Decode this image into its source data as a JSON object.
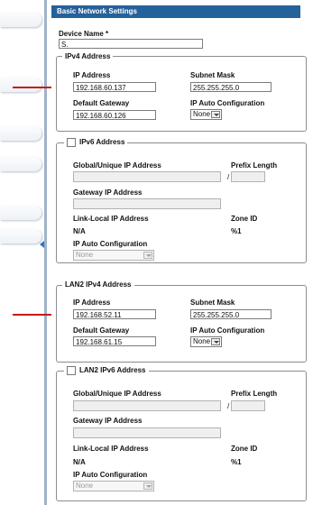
{
  "panel": {
    "title": "Basic Network Settings"
  },
  "device": {
    "name_label": "Device Name *",
    "name_value": "S."
  },
  "ipv4": {
    "legend": "IPv4 Address",
    "ip_label": "IP Address",
    "ip_value": "192.168.60.137",
    "mask_label": "Subnet Mask",
    "mask_value": "255.255.255.0",
    "gateway_label": "Default Gateway",
    "gateway_value": "192.168.60.126",
    "auto_label": "IP Auto Configuration",
    "auto_value": "None"
  },
  "ipv6": {
    "legend": "IPv6 Address",
    "global_label": "Global/Unique IP Address",
    "prefix_label": "Prefix Length",
    "slash": "/",
    "gateway_label": "Gateway IP Address",
    "linklocal_label": "Link-Local IP Address",
    "linklocal_value": "N/A",
    "zone_label": "Zone ID",
    "zone_value": "%1",
    "auto_label": "IP Auto Configuration",
    "auto_value": "None"
  },
  "lan2_ipv4": {
    "legend": "LAN2 IPv4 Address",
    "ip_label": "IP Address",
    "ip_value": "192.168.52.11",
    "mask_label": "Subnet Mask",
    "mask_value": "255.255.255.0",
    "gateway_label": "Default Gateway",
    "gateway_value": "192.168.61.15",
    "auto_label": "IP Auto Configuration",
    "auto_value": "None"
  },
  "lan2_ipv6": {
    "legend": "LAN2 IPv6 Address",
    "global_label": "Global/Unique IP Address",
    "prefix_label": "Prefix Length",
    "slash": "/",
    "gateway_label": "Gateway IP Address",
    "linklocal_label": "Link-Local IP Address",
    "linklocal_value": "N/A",
    "zone_label": "Zone ID",
    "zone_value": "%1",
    "auto_label": "IP Auto Configuration",
    "auto_value": "None"
  },
  "colors": {
    "header_bg": "#25619b",
    "arrow": "#c81919",
    "sidebar_edge": "#9fb3c8"
  }
}
